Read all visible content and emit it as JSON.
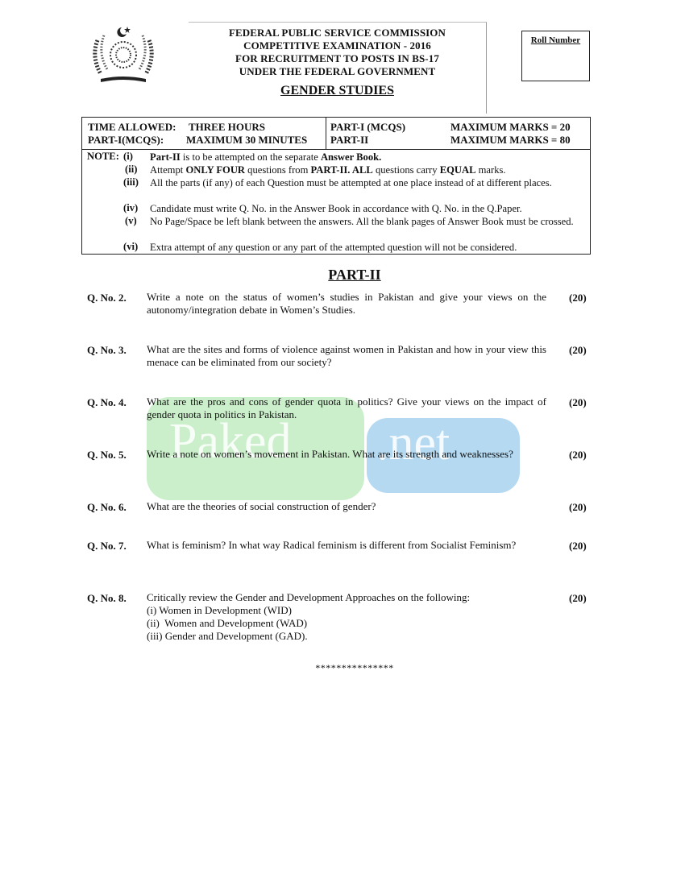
{
  "header": {
    "emblem_icon": "government-emblem-icon",
    "title_lines": [
      "FEDERAL PUBLIC SERVICE COMMISSION",
      "COMPETITIVE EXAMINATION - 2016",
      "FOR RECRUITMENT TO POSTS IN BS-17",
      "UNDER THE FEDERAL GOVERNMENT"
    ],
    "subject": "GENDER STUDIES",
    "roll_number_label": "Roll Number"
  },
  "info_table": {
    "time_allowed_label": "TIME ALLOWED:",
    "time_allowed_value": "THREE HOURS",
    "mcq_time_label": "PART-I(MCQS):",
    "mcq_time_value": "MAXIMUM 30 MINUTES",
    "part1_label": "PART-I (MCQS)",
    "part1_marks": "MAXIMUM MARKS = 20",
    "part2_label": "PART-II",
    "part2_marks": "MAXIMUM MARKS = 80"
  },
  "notes": {
    "label": "NOTE:",
    "items": [
      {
        "num": "(i)",
        "html_parts": [
          "Part-II",
          " is to be attempted on the separate ",
          "Answer Book."
        ]
      },
      {
        "num": "(ii)",
        "html_parts": [
          "Attempt ",
          "ONLY FOUR",
          " questions from ",
          "PART-II. ALL",
          " questions carry ",
          "EQUAL",
          " marks."
        ]
      },
      {
        "num": "(iii)",
        "text": "All the parts (if any) of each Question must be attempted at one place instead of at different places."
      },
      {
        "num": "(iv)",
        "text": "Candidate must write Q. No. in the Answer Book in accordance with Q. No. in the Q.Paper."
      },
      {
        "num": "(v)",
        "text": "No Page/Space be left blank between the answers. All the blank pages of Answer Book must be crossed."
      },
      {
        "num": "(vi)",
        "text": "Extra attempt of any question or any part of the attempted question will not be considered."
      }
    ]
  },
  "part2": {
    "heading": "PART-II",
    "questions": [
      {
        "label": "Q. No. 2.",
        "text": "Write a note on the status of women’s studies in Pakistan and give your views on the autonomy/integration debate in Women’s Studies.",
        "marks": "(20)"
      },
      {
        "label": "Q. No. 3.",
        "text": "What are the sites and forms of violence against women in Pakistan and how in your view this menace can be eliminated from our society?",
        "marks": "(20)"
      },
      {
        "label": "Q. No. 4.",
        "text": "What are the pros and cons of gender quota in politics? Give your views on the impact of gender quota in politics in Pakistan.",
        "marks": "(20)"
      },
      {
        "label": "Q. No. 5.",
        "text": "Write a note on women’s movement in Pakistan. What are its strength and weaknesses?",
        "marks": "(20)"
      },
      {
        "label": "Q. No. 6.",
        "text": "What are the theories of social construction of gender?",
        "marks": "(20)"
      },
      {
        "label": "Q. No. 7.",
        "text": "What is feminism? In what way Radical feminism is different from Socialist Feminism?",
        "marks": "(20)"
      },
      {
        "label": "Q. No. 8.",
        "text": "Critically review the Gender and Development Approaches on the following:",
        "marks": "(20)",
        "sub_items": [
          "(i) Women in Development (WID)",
          "(ii)  Women and Development (WAD)",
          "(iii) Gender and Development (GAD)."
        ]
      }
    ],
    "end_marker": "***************"
  },
  "watermark": {
    "part1": "Paked",
    "part2": ".net",
    "colors": {
      "green": "#a0e1a0",
      "blue": "#78b9e6"
    }
  }
}
